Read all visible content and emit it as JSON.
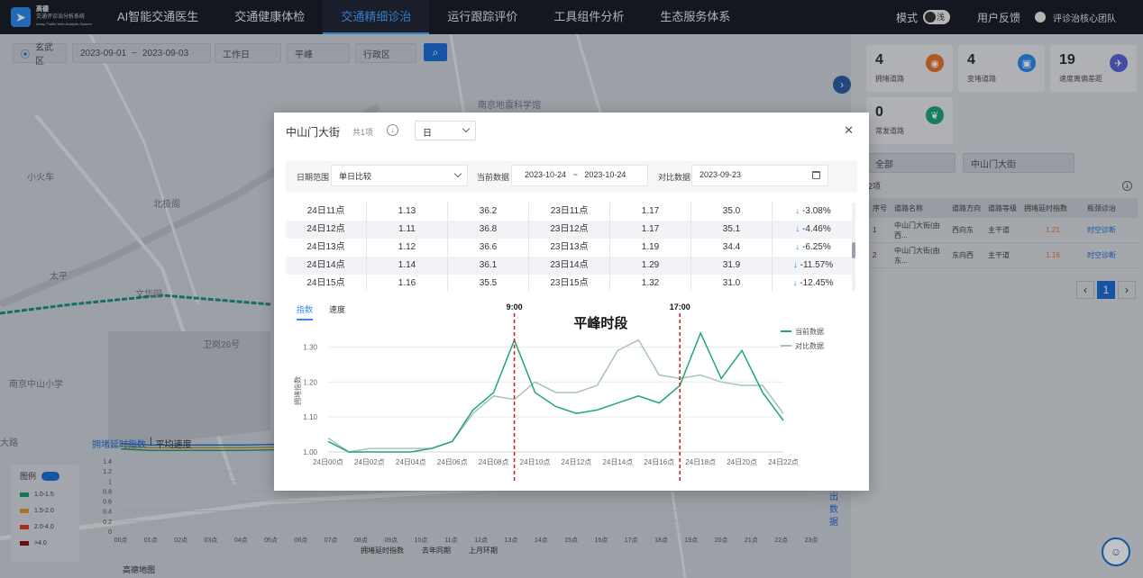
{
  "app": {
    "logo_line1": "高德",
    "logo_line2": "交通评诊治分析系统",
    "logo_line3": "Amap Traffic Web Analysis System"
  },
  "nav": {
    "tabs": [
      {
        "label": "AI智能交通医生"
      },
      {
        "label": "交通健康体检"
      },
      {
        "label": "交通精细诊治"
      },
      {
        "label": "运行跟踪评价"
      },
      {
        "label": "工具组件分析"
      },
      {
        "label": "生态服务体系"
      }
    ],
    "mode_label": "模式",
    "mode_toggle": "浅",
    "feedback": "用户反馈",
    "team": "评诊治核心团队"
  },
  "filters": {
    "district": "玄武区",
    "date_start": "2023-09-01",
    "date_sep": "~",
    "date_end": "2023-09-03",
    "day_type": "工作日",
    "peak": "平峰",
    "region": "行政区"
  },
  "map_labels": [
    "南京地震科学馆",
    "文华园",
    "卫岗26号",
    "南京中山小学",
    "小火车",
    "北极阁",
    "太平",
    "大路"
  ],
  "stats": [
    {
      "num": "4",
      "label": "拥堵道路",
      "color": "#e8742c"
    },
    {
      "num": "4",
      "label": "变堵道路",
      "color": "#2d8cf0"
    },
    {
      "num": "19",
      "label": "速度离偏差距",
      "color": "#5a66d6"
    },
    {
      "num": "0",
      "label": "常发道路",
      "color": "#1fa67a"
    }
  ],
  "right_table": {
    "filter_all": "全部",
    "search_placeholder": "中山门大街",
    "count": "2项",
    "headers": [
      "序号",
      "道路名称",
      "道路方向",
      "道路等级",
      "拥堵延时指数",
      "瓶颈诊治"
    ],
    "rows": [
      {
        "no": "1",
        "name": "中山门大街(由西...",
        "dir": "西向东",
        "level": "主干道",
        "index": "1.21",
        "action": "时空诊断"
      },
      {
        "no": "2",
        "name": "中山门大街(由东...",
        "dir": "东向西",
        "level": "主干道",
        "index": "1.16",
        "action": "时空诊断"
      }
    ],
    "page": "1"
  },
  "legend": {
    "title": "图例",
    "items": [
      {
        "label": "1.0-1.5",
        "color": "#1a9b6a"
      },
      {
        "label": "1.5-2.0",
        "color": "#e09a2a"
      },
      {
        "label": "2.0-4.0",
        "color": "#d9402b"
      },
      {
        "label": ">4.0",
        "color": "#8a1212"
      }
    ]
  },
  "bottom_chart": {
    "tab1": "拥堵延时指数",
    "tab_sep": "|",
    "tab2": "平均速度",
    "legend": [
      "拥堵延时指数",
      "去年同期",
      "上月环期"
    ],
    "side": "出数据",
    "hours": [
      "00点",
      "01点",
      "02点",
      "03点",
      "04点",
      "05点",
      "06点",
      "07点",
      "08点",
      "09点",
      "10点",
      "11点",
      "12点",
      "13点",
      "14点",
      "15点",
      "16点",
      "17点",
      "18点",
      "19点",
      "20点",
      "21点",
      "22点",
      "23点"
    ],
    "y_ticks": [
      "1.4",
      "1.2",
      "1",
      "0.8",
      "0.6",
      "0.4",
      "0.2",
      "0"
    ],
    "brand": "高德地图"
  },
  "modal": {
    "title": "中山门大街",
    "count": "共1项",
    "granularity": "日",
    "filter": {
      "range_label": "日期范围",
      "range_value": "单日比较",
      "current_label": "当前数据",
      "current_start": "2023-10-24",
      "current_sep": "~",
      "current_end": "2023-10-24",
      "compare_label": "对比数据",
      "compare_date": "2023-09-23"
    },
    "rows": [
      [
        "24日11点",
        "1.13",
        "36.2",
        "23日11点",
        "1.17",
        "35.0",
        "-3.08%"
      ],
      [
        "24日12点",
        "1.11",
        "36.8",
        "23日12点",
        "1.17",
        "35.1",
        "-4.46%"
      ],
      [
        "24日13点",
        "1.12",
        "36.6",
        "23日13点",
        "1.19",
        "34.4",
        "-6.25%"
      ],
      [
        "24日14点",
        "1.14",
        "36.1",
        "23日14点",
        "1.29",
        "31.9",
        "-11.57%"
      ],
      [
        "24日15点",
        "1.16",
        "35.5",
        "23日15点",
        "1.32",
        "31.0",
        "-12.45%"
      ]
    ],
    "chart_tabs": [
      "指数",
      "速度"
    ]
  },
  "chart_data": {
    "type": "line",
    "title": "",
    "xlabel": "",
    "ylabel": "拥堵指数",
    "x": [
      "24日00点",
      "24日01点",
      "24日02点",
      "24日03点",
      "24日04点",
      "24日05点",
      "24日06点",
      "24日07点",
      "24日08点",
      "24日09点",
      "24日10点",
      "24日11点",
      "24日12点",
      "24日13点",
      "24日14点",
      "24日15点",
      "24日16点",
      "24日17点",
      "24日18点",
      "24日19点",
      "24日20点",
      "24日21点",
      "24日22点"
    ],
    "x_ticks": [
      "24日00点",
      "24日02点",
      "24日04点",
      "24日06点",
      "24日08点",
      "24日10点",
      "24日12点",
      "24日14点",
      "24日16点",
      "24日18点",
      "24日20点",
      "24日22点"
    ],
    "y_ticks": [
      "1.00",
      "1.10",
      "1.20",
      "1.30"
    ],
    "ylim": [
      1.0,
      1.35
    ],
    "series": [
      {
        "name": "当前数据",
        "color": "#1fa67a",
        "values": [
          1.03,
          1.0,
          1.0,
          1.0,
          1.0,
          1.01,
          1.03,
          1.12,
          1.17,
          1.32,
          1.17,
          1.13,
          1.11,
          1.12,
          1.14,
          1.16,
          1.14,
          1.19,
          1.34,
          1.21,
          1.29,
          1.17,
          1.09,
          1.02
        ]
      },
      {
        "name": "对比数据",
        "color": "#a8c4b8",
        "values": [
          1.04,
          1.0,
          1.01,
          1.01,
          1.01,
          1.01,
          1.03,
          1.11,
          1.16,
          1.15,
          1.2,
          1.17,
          1.17,
          1.19,
          1.29,
          1.32,
          1.22,
          1.21,
          1.22,
          1.2,
          1.19,
          1.19,
          1.11,
          1.06
        ]
      }
    ],
    "annotations": [
      {
        "label": "9:00",
        "at": "24日09点"
      },
      {
        "label": "17:00",
        "at": "24日17点"
      },
      {
        "label": "平峰时段",
        "at": "24日13点"
      }
    ],
    "grid": true,
    "legend_position": "top-right"
  }
}
